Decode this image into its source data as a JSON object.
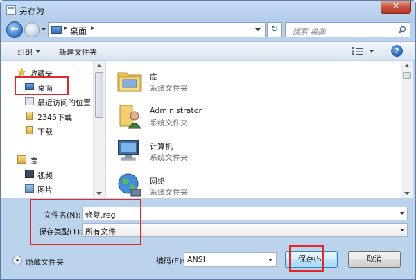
{
  "window": {
    "title": "另存为",
    "close_glyph": "✕"
  },
  "nav": {
    "back_glyph": "←",
    "address": "桌面",
    "crumb_arrow": "►",
    "refresh_glyph": "↻",
    "search_placeholder": "搜索 桌面"
  },
  "toolbar": {
    "organize": "组织",
    "new_folder": "新建文件夹",
    "help": "?"
  },
  "sidebar": {
    "favorites_header": "收藏夹",
    "favorites": [
      "桌面",
      "最近访问的位置",
      "2345下载",
      "下载"
    ],
    "libraries_header": "库",
    "libraries": [
      "视频",
      "图片"
    ]
  },
  "files": [
    {
      "name": "库",
      "type": "系统文件夹",
      "icon": "library-folder-icon"
    },
    {
      "name": "Administrator",
      "type": "系统文件夹",
      "icon": "user-folder-icon"
    },
    {
      "name": "计算机",
      "type": "系统文件夹",
      "icon": "computer-icon"
    },
    {
      "name": "网络",
      "type": "系统文件夹",
      "icon": "network-globe-icon"
    }
  ],
  "form": {
    "filename_label": "文件名(N):",
    "filename_value": "修复.reg",
    "filetype_label": "保存类型(T):",
    "filetype_value": "所有文件"
  },
  "footer": {
    "hide_folders": "隐藏文件夹",
    "encoding_label": "编码(E):",
    "encoding_value": "ANSI",
    "save": "保存(S)",
    "cancel": "取消"
  },
  "colors": {
    "highlight_box": "#e3262c",
    "window_frame": "#b4cde9"
  }
}
